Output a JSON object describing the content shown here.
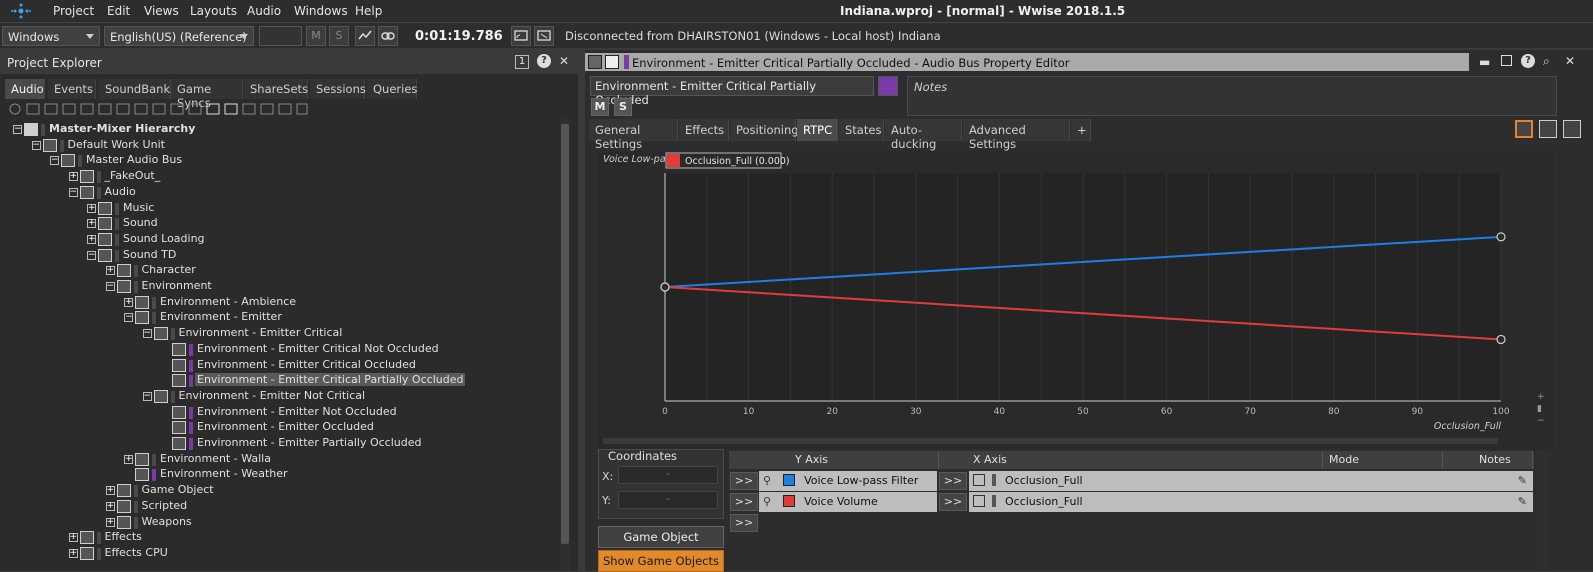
{
  "menubar": {
    "items": [
      "Project",
      "Edit",
      "Views",
      "Layouts",
      "Audio",
      "Windows",
      "Help"
    ],
    "title": "Indiana.wproj - [normal] - Wwise 2018.1.5"
  },
  "toolbar": {
    "platform": "Windows",
    "language": "English(US) (Reference)",
    "mute_label": "M",
    "solo_label": "S",
    "timecode": "0:01:19.786",
    "connection_status": "Disconnected from DHAIRSTON01 (Windows - Local host) Indiana"
  },
  "project_explorer": {
    "title": "Project Explorer",
    "badge": "1",
    "help": "?",
    "close": "✕",
    "tabs": [
      "Audio",
      "Events",
      "SoundBanks",
      "Game Syncs",
      "ShareSets",
      "Sessions",
      "Queries"
    ],
    "tree": [
      {
        "label": "Master-Mixer Hierarchy",
        "exp": "−",
        "bold": true
      },
      {
        "label": "Default Work Unit",
        "exp": "−"
      },
      {
        "label": "Master Audio Bus",
        "exp": "−"
      },
      {
        "label": "_FakeOut_",
        "exp": "+"
      },
      {
        "label": "Audio",
        "exp": "−"
      },
      {
        "label": "Music",
        "exp": "+"
      },
      {
        "label": "Sound",
        "exp": "+"
      },
      {
        "label": "Sound Loading",
        "exp": "+"
      },
      {
        "label": "Sound TD",
        "exp": "−"
      },
      {
        "label": "Character",
        "exp": "+"
      },
      {
        "label": "Environment",
        "exp": "−"
      },
      {
        "label": "Environment - Ambience",
        "exp": "+"
      },
      {
        "label": "Environment - Emitter",
        "exp": "−"
      },
      {
        "label": "Environment - Emitter Critical",
        "exp": "−"
      },
      {
        "label": "Environment - Emitter Critical Not Occluded",
        "exp": "",
        "purple": true
      },
      {
        "label": "Environment - Emitter Critical Occluded",
        "exp": "",
        "purple": true
      },
      {
        "label": "Environment - Emitter Critical Partially Occluded",
        "exp": "",
        "purple": true,
        "selected": true
      },
      {
        "label": "Environment - Emitter Not Critical",
        "exp": "−"
      },
      {
        "label": "Environment - Emitter Not Occluded",
        "exp": "",
        "purple": true
      },
      {
        "label": "Environment - Emitter Occluded",
        "exp": "",
        "purple": true
      },
      {
        "label": "Environment - Emitter Partially Occluded",
        "exp": "",
        "purple": true
      },
      {
        "label": "Environment - Walla",
        "exp": "+"
      },
      {
        "label": "Environment - Weather",
        "exp": "",
        "purple": true
      },
      {
        "label": "Game Object",
        "exp": "+"
      },
      {
        "label": "Scripted",
        "exp": "+"
      },
      {
        "label": "Weapons",
        "exp": "+"
      },
      {
        "label": "Effects",
        "exp": "+"
      },
      {
        "label": "Effects CPU",
        "exp": "+"
      }
    ]
  },
  "property_editor": {
    "title": "Environment - Emitter Critical Partially Occluded - Audio Bus Property Editor",
    "object_name": "Environment - Emitter Critical Partially Occluded",
    "notes_placeholder": "Notes",
    "mute_label": "M",
    "solo_label": "S",
    "tabs": [
      "General Settings",
      "Effects",
      "Positioning",
      "RTPC",
      "States",
      "Auto-ducking",
      "Advanced Settings",
      "+"
    ],
    "active_tab": "RTPC",
    "graph": {
      "y_label": "Voice Low-pass",
      "tag": "Occlusion_Full (0.000)",
      "x_axis_name": "Occlusion_Full",
      "x_ticks": [
        "0",
        "10",
        "20",
        "30",
        "40",
        "50",
        "60",
        "70",
        "80",
        "90",
        "100"
      ]
    },
    "coordinates": {
      "title": "Coordinates",
      "x_label": "X:",
      "y_label": "Y:",
      "x_value": "-",
      "y_value": "-"
    },
    "table": {
      "headers": {
        "y_axis": "Y Axis",
        "x_axis": "X Axis",
        "mode": "Mode",
        "notes": "Notes"
      },
      "rows": [
        {
          "y_axis": "Voice Low-pass Filter",
          "x_axis": "Occlusion_Full",
          "color": "#1e7ee8"
        },
        {
          "y_axis": "Voice Volume",
          "x_axis": "Occlusion_Full",
          "color": "#e23b3b"
        }
      ],
      "expand_label": ">>"
    },
    "buttons": {
      "game_object_explorer": "Game Object Explorer...",
      "show_game_objects": "Show Game Objects"
    }
  },
  "chart_data": {
    "type": "line",
    "title": "",
    "xlabel": "Occlusion_Full",
    "ylabel": "Voice Low-pass",
    "xlim": [
      0,
      100
    ],
    "ylim": [
      0,
      1
    ],
    "categories": [
      "0",
      "10",
      "20",
      "30",
      "40",
      "50",
      "60",
      "70",
      "80",
      "90",
      "100"
    ],
    "series": [
      {
        "name": "Voice Low-pass Filter",
        "color": "#1e7ee8",
        "points": [
          [
            0,
            0.5
          ],
          [
            100,
            0.72
          ]
        ]
      },
      {
        "name": "Voice Volume",
        "color": "#e23b3b",
        "points": [
          [
            0,
            0.5
          ],
          [
            100,
            0.27
          ]
        ]
      }
    ]
  }
}
